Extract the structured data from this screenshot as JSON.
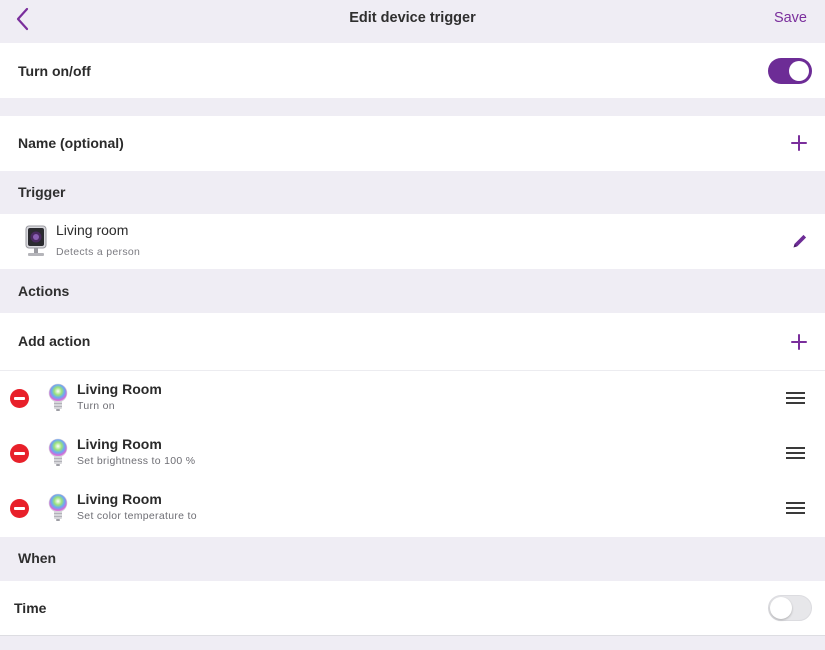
{
  "header": {
    "title": "Edit device trigger",
    "save_label": "Save"
  },
  "toggle_row": {
    "label": "Turn on/off",
    "enabled": true
  },
  "name_row": {
    "label": "Name (optional)"
  },
  "sections": {
    "trigger": "Trigger",
    "actions": "Actions",
    "when": "When"
  },
  "trigger_item": {
    "name": "Living room",
    "description": "Detects a person"
  },
  "add_action": {
    "label": "Add action"
  },
  "actions": [
    {
      "title": "Living Room",
      "subtitle": "Turn on"
    },
    {
      "title": "Living Room",
      "subtitle": "Set brightness to 100 %"
    },
    {
      "title": "Living Room",
      "subtitle": "Set color temperature to"
    }
  ],
  "time_row": {
    "label": "Time",
    "enabled": false
  },
  "colors": {
    "accent": "#6d2c96",
    "remove": "#e8202a",
    "background": "#efedf4"
  }
}
